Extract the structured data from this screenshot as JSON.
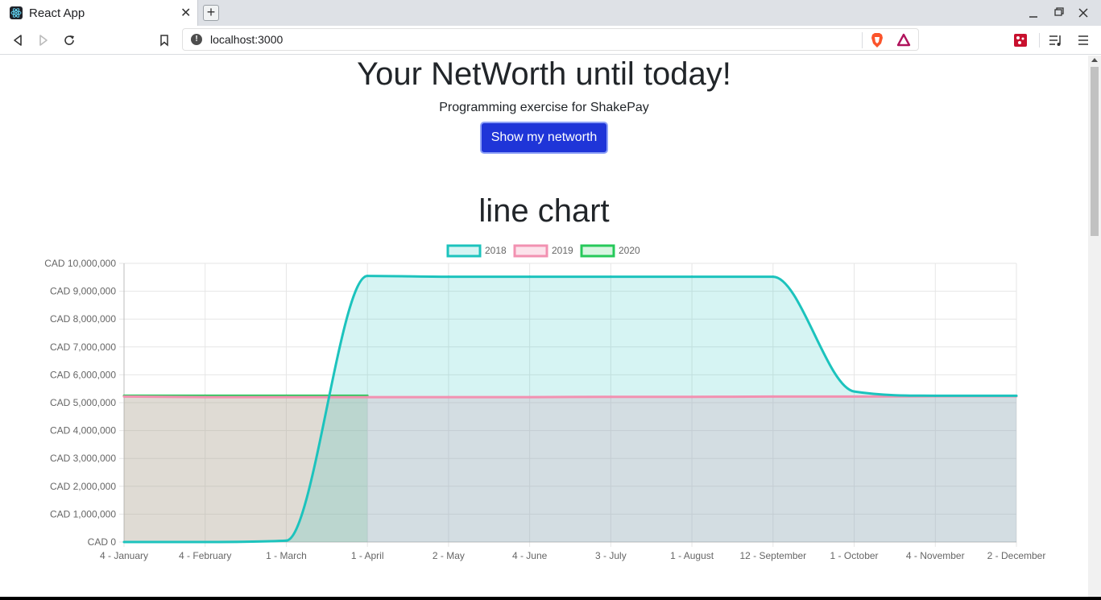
{
  "browser": {
    "tab_title": "React App",
    "tab_close": "✕",
    "new_tab": "+",
    "url": "localhost:3000"
  },
  "page": {
    "title": "Your NetWorth until today!",
    "subtitle": "Programming exercise for ShakePay",
    "button_label": "Show my networth",
    "chart_heading": "line chart"
  },
  "colors": {
    "button": "#1f35d8",
    "series_2018": "#1cc3bd",
    "series_2019": "#f291b1",
    "series_2020": "#26c95a"
  },
  "chart_data": {
    "type": "line",
    "categories": [
      "4 - January",
      "4 - February",
      "1 - March",
      "1 - April",
      "2 - May",
      "4 - June",
      "3 - July",
      "1 - August",
      "12 - September",
      "1 - October",
      "4 - November",
      "2 - December"
    ],
    "series": [
      {
        "name": "2018",
        "color": "#1cc3bd",
        "fill": "rgba(28,195,189,0.18)",
        "values": [
          0,
          0,
          50000,
          9550000,
          9520000,
          9520000,
          9520000,
          9520000,
          9520000,
          5400000,
          5250000,
          5250000
        ]
      },
      {
        "name": "2019",
        "color": "#f291b1",
        "fill": "rgba(242,145,177,0.25)",
        "values": [
          5220000,
          5200000,
          5200000,
          5200000,
          5200000,
          5200000,
          5210000,
          5210000,
          5220000,
          5220000,
          5230000,
          5230000
        ]
      },
      {
        "name": "2020",
        "color": "#26c95a",
        "fill": "rgba(38,201,90,0.18)",
        "values": [
          5250000,
          5250000,
          5250000,
          5250000
        ]
      }
    ],
    "y_ticks": [
      "CAD 0",
      "CAD 1,000,000",
      "CAD 2,000,000",
      "CAD 3,000,000",
      "CAD 4,000,000",
      "CAD 5,000,000",
      "CAD 6,000,000",
      "CAD 7,000,000",
      "CAD 8,000,000",
      "CAD 9,000,000",
      "CAD 10,000,000"
    ],
    "ylim": [
      0,
      10000000
    ],
    "grid": true,
    "legend": "top"
  }
}
